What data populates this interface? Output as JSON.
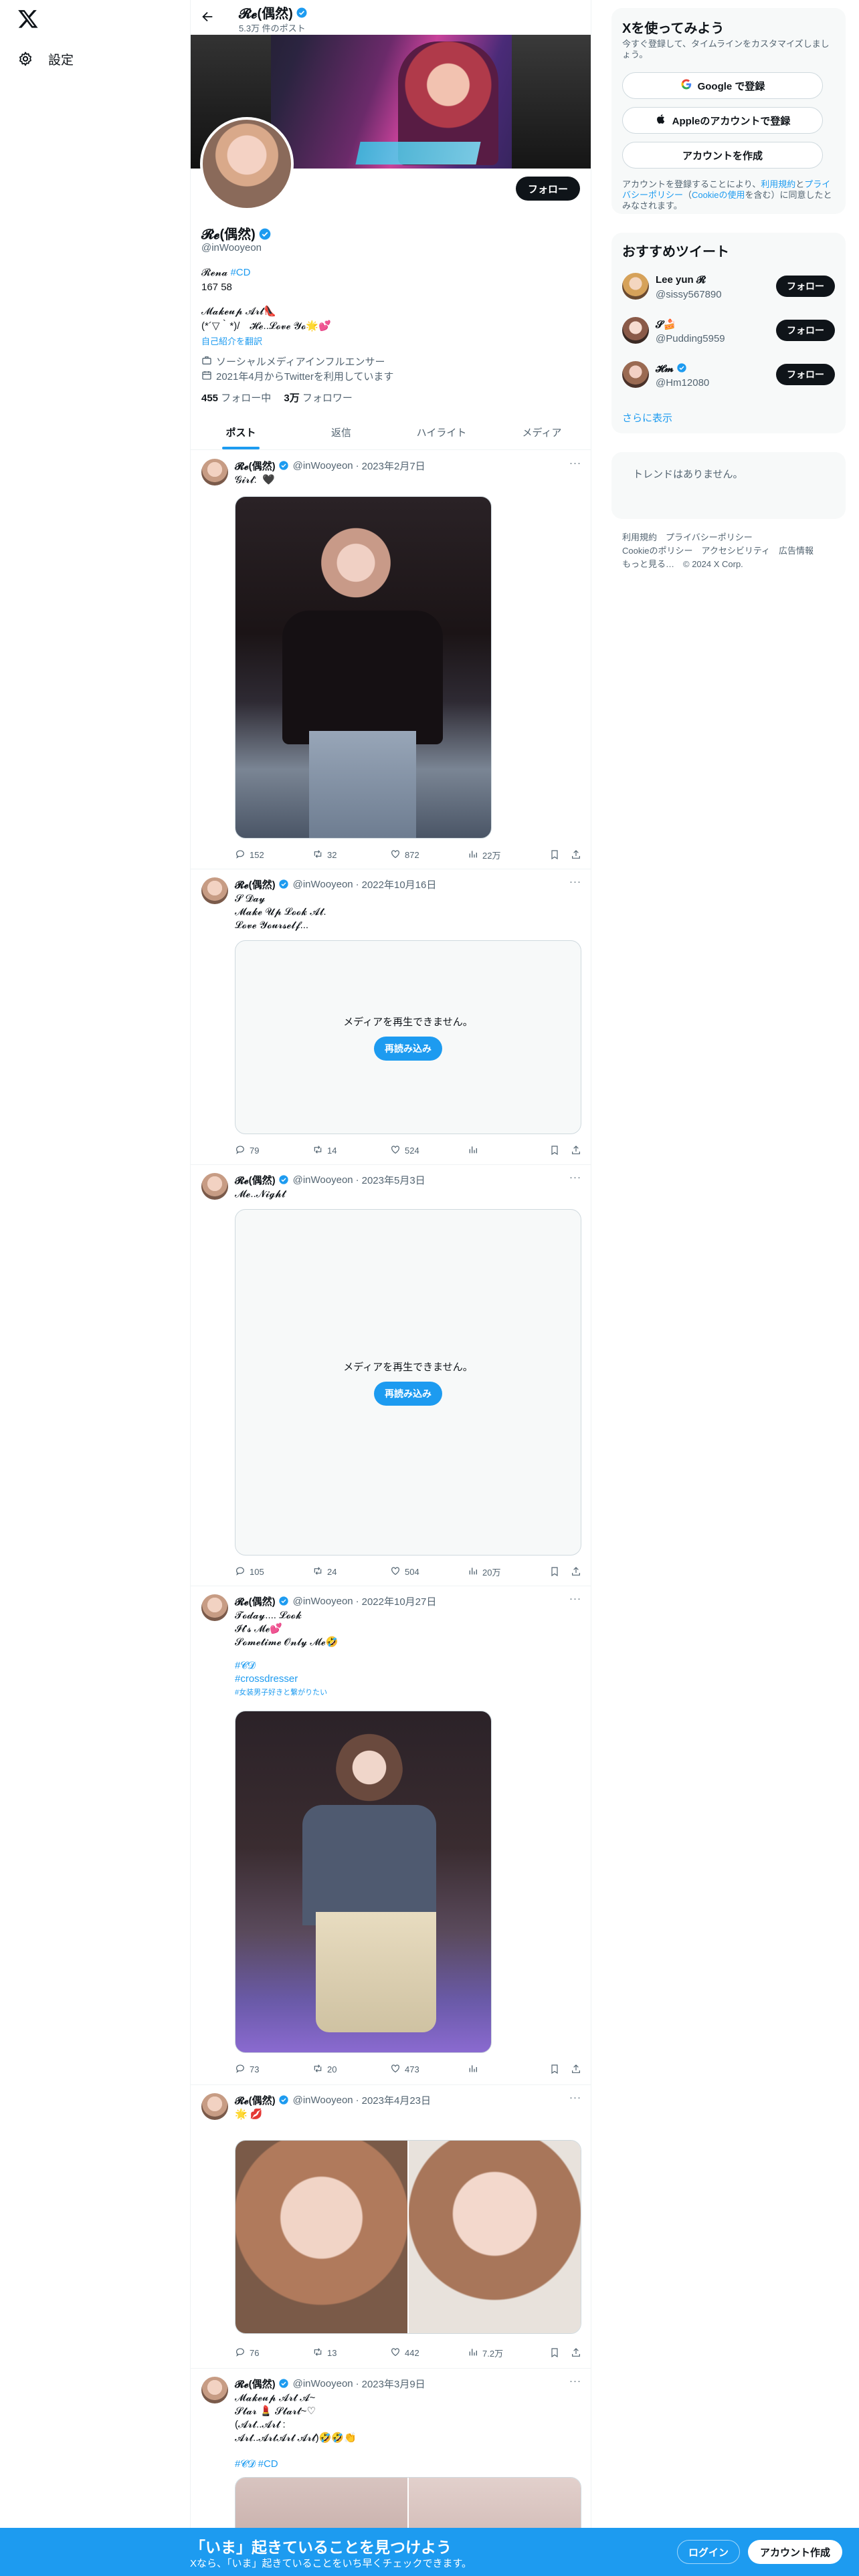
{
  "nav": {
    "settings_label": "設定"
  },
  "topbar": {
    "name": "𝓡𝓮(偶然)",
    "post_count": "5.3万 件のポスト"
  },
  "profile": {
    "name": "𝓡𝓮(偶然)",
    "handle": "@inWooyeon",
    "follow_label": "フォロー",
    "bio_line1_a": "𝓡𝓮𝓷𝓪",
    "bio_line1_tag": "#CD",
    "bio_line2": "167 58",
    "bio_line3": "𝓜𝓪𝓴𝓮𝓾𝓹 𝓐𝓻𝓽👠",
    "bio_line4": "(*´▽｀*)/　𝓗𝓮..𝓛𝓸𝓿𝓮 𝓨𝓸🌟💕",
    "translate_label": "自己紹介を翻訳",
    "category": "ソーシャルメディアインフルエンサー",
    "joined": "2021年4月からTwitterを利用しています",
    "following_num": "455",
    "following_label": " フォロー中",
    "followers_num": "3万",
    "followers_label": " フォロワー"
  },
  "tabs": [
    {
      "label": "ポスト"
    },
    {
      "label": "返信"
    },
    {
      "label": "ハイライト"
    },
    {
      "label": "メディア"
    }
  ],
  "tweets": [
    {
      "name": "𝓡𝓮(偶然)",
      "handle": "@inWooyeon",
      "date": "2023年2月7日",
      "text": "𝓖𝓲𝓻𝓵:  🖤",
      "replies": "152",
      "retweets": "32",
      "likes": "872",
      "views": "22万"
    },
    {
      "name": "𝓡𝓮(偶然)",
      "handle": "@inWooyeon",
      "date": "2022年10月16日",
      "text": "𝓢 𝓓𝓪𝔂\n𝓜𝓪𝓴𝓮 𝓤𝓹 𝓛𝓸𝓸𝓴 𝓐𝓽.\n𝓛𝓸𝓿𝓮 𝓨𝓸𝓾𝓻𝓼𝓮𝓵𝓯...",
      "media_error": "メディアを再生できません。",
      "retry": "再読み込み",
      "replies": "79",
      "retweets": "14",
      "likes": "524",
      "views": ""
    },
    {
      "name": "𝓡𝓮(偶然)",
      "handle": "@inWooyeon",
      "date": "2023年5月3日",
      "text": "𝓜𝓮..𝓝𝓲𝓰𝓱𝓽",
      "media_error": "メディアを再生できません。",
      "retry": "再読み込み",
      "replies": "105",
      "retweets": "24",
      "likes": "504",
      "views": "20万"
    },
    {
      "name": "𝓡𝓮(偶然)",
      "handle": "@inWooyeon",
      "date": "2022年10月27日",
      "text": "𝓣𝓸𝓭𝓪𝔂.... 𝓛𝓸𝓸𝓴\n𝓘𝓽'𝓼 𝓜𝓮💕\n𝓢𝓸𝓶𝓮𝓽𝓲𝓶𝓮 𝓞𝓷𝓵𝔂 𝓜𝓮🤣",
      "tag1": "#𝓒𝓓",
      "tag2": "#crossdresser",
      "tag3": "#女装男子好きと繋がりたい",
      "replies": "73",
      "retweets": "20",
      "likes": "473",
      "views": ""
    },
    {
      "name": "𝓡𝓮(偶然)",
      "handle": "@inWooyeon",
      "date": "2023年4月23日",
      "text": "🌟 💋",
      "replies": "76",
      "retweets": "13",
      "likes": "442",
      "views": "7.2万"
    },
    {
      "name": "𝓡𝓮(偶然)",
      "handle": "@inWooyeon",
      "date": "2023年3月9日",
      "text": "𝓜𝓪𝓴𝓮𝓾𝓹 𝓐𝓻𝓽 𝓐~\n𝓢𝓽𝓪𝓻 💄 𝓢𝓽𝓪𝓻𝓽~♡\n(𝓐𝓻𝓽..𝓐𝓻𝓽 :\n𝓐𝓻𝓽..𝓐𝓻𝓽𝓐𝓻𝓽 𝓐𝓻𝓽)🤣🤣👏",
      "tag1": "#𝓒𝓓 #CD"
    }
  ],
  "right": {
    "signup_title": "Xを使ってみよう",
    "signup_sub": "今すぐ登録して、タイムラインをカスタマイズしましょう。",
    "google_btn": "Google で登録",
    "apple_btn": "Appleのアカウントで登録",
    "create_btn": "アカウントを作成",
    "legal_a": "アカウントを登録することにより、",
    "legal_terms": "利用規約",
    "legal_b": "と",
    "legal_privacy": "プライバシーポリシー",
    "legal_c": "（",
    "legal_cookie": "Cookieの使用",
    "legal_d": "を含む）に同意したとみなされます。",
    "wtf_title": "おすすめツイート",
    "wtf": [
      {
        "name": "Lee yun 𝓡",
        "handle": "@sissy567890",
        "follow": "フォロー"
      },
      {
        "name": "𝓢🍰",
        "handle": "@Pudding5959",
        "follow": "フォロー"
      },
      {
        "name": "𝓗𝓶",
        "handle": "@Hm12080",
        "follow": "フォロー"
      }
    ],
    "wtf_more": "さらに表示",
    "trends_empty": "トレンドはありません。",
    "footer_l1": "利用規約　プライバシーポリシー",
    "footer_l2": "Cookieのポリシー　アクセシビリティ　広告情報",
    "footer_l3": "もっと見る…　© 2024 X Corp."
  },
  "bottom": {
    "title": "「いま」起きていることを見つけよう",
    "sub": "Xなら、「いま」起きていることをいち早くチェックできます。",
    "login": "ログイン",
    "signup": "アカウント作成"
  },
  "colors": {
    "accent": "#1d9bf0",
    "text": "#0f1419",
    "muted": "#536471"
  }
}
